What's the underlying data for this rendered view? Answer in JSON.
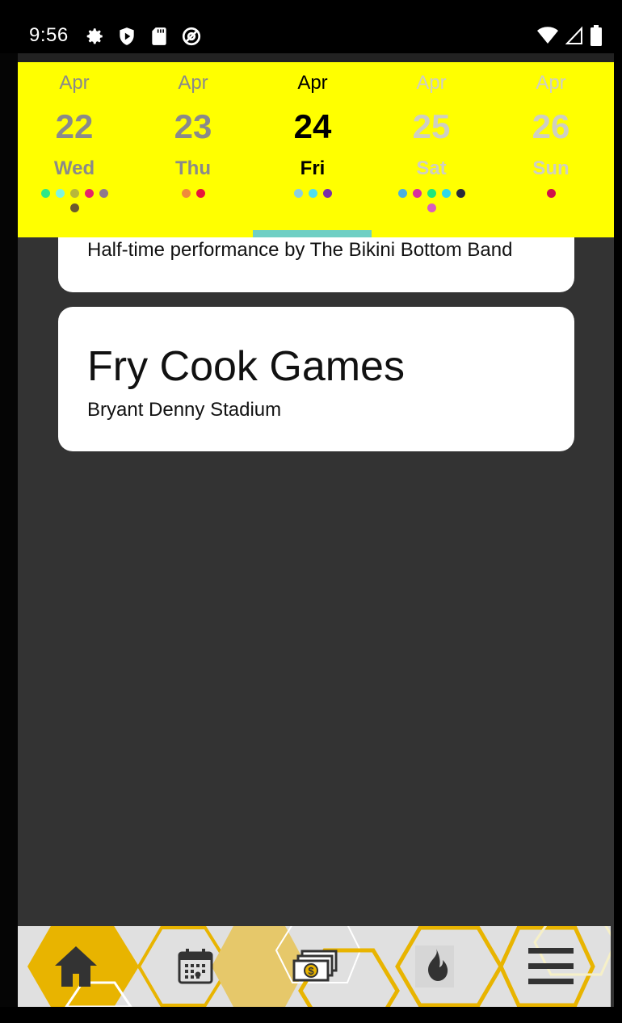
{
  "status_bar": {
    "time": "9:56",
    "left_icons": [
      "gear-icon",
      "shield-play-icon",
      "sd-card-icon",
      "at-sign-icon"
    ],
    "right_icons": [
      "wifi-icon",
      "signal-icon",
      "battery-icon"
    ]
  },
  "date_bar": {
    "selected_index": 2,
    "indicator_color": "#6FCFC4",
    "background": "#FFFF00",
    "days": [
      {
        "month": "Apr",
        "day": "22",
        "weekday": "Wed",
        "style": "grey",
        "dots": [
          "#2EE887",
          "#7FF5E0",
          "#B8B83A",
          "#E6236B",
          "#8E7A8E",
          "#6B5A2E"
        ]
      },
      {
        "month": "Apr",
        "day": "23",
        "weekday": "Thu",
        "style": "grey",
        "dots": [
          "#F08A3A",
          "#E8163A"
        ]
      },
      {
        "month": "Apr",
        "day": "24",
        "weekday": "Fri",
        "style": "active",
        "dots": [
          "#8ACFE0",
          "#4EE0F0",
          "#7A2EA8"
        ]
      },
      {
        "month": "Apr",
        "day": "25",
        "weekday": "Sat",
        "style": "light",
        "dots": [
          "#4AB0E0",
          "#D82E9E",
          "#1EE87A",
          "#2ED8E8",
          "#2A2A3A",
          "#D85EBE"
        ]
      },
      {
        "month": "Apr",
        "day": "26",
        "weekday": "Sun",
        "style": "light",
        "dots": [
          "#D0104A"
        ]
      }
    ]
  },
  "events": [
    {
      "description": "Half-time performance by The Bikini Bottom Band"
    },
    {
      "title": "Fry Cook Games",
      "location": "Bryant Denny Stadium"
    }
  ],
  "nav": {
    "items": [
      {
        "icon": "home-icon",
        "active": true
      },
      {
        "icon": "calendar-icon",
        "active": false
      },
      {
        "icon": "money-icon",
        "active": false
      },
      {
        "icon": "fire-icon",
        "active": false
      },
      {
        "icon": "menu-icon",
        "active": false
      }
    ],
    "accent": "#E8B400"
  }
}
